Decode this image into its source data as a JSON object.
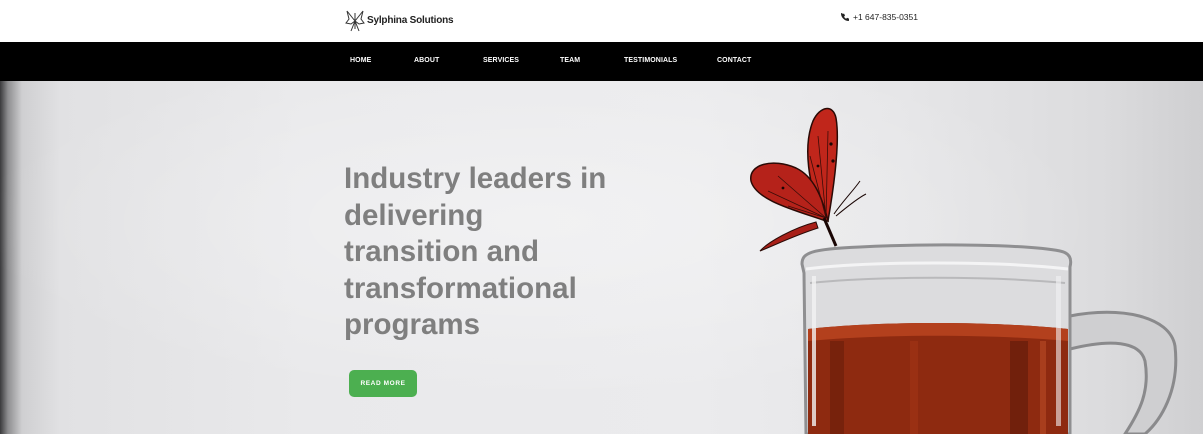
{
  "brand": {
    "name": "Sylphina Solutions",
    "logo_icon": "butterfly-logo-icon"
  },
  "contact": {
    "phone": "+1 647-835-0351",
    "phone_icon": "phone-icon"
  },
  "nav": {
    "items": [
      {
        "label": "HOME"
      },
      {
        "label": "ABOUT"
      },
      {
        "label": "SERVICES"
      },
      {
        "label": "TEAM"
      },
      {
        "label": "TESTIMONIALS"
      },
      {
        "label": "CONTACT"
      }
    ]
  },
  "hero": {
    "headline_lines": [
      "Industry leaders in",
      "delivering",
      "transition and",
      "transformational",
      "programs"
    ],
    "cta_label": "READ MORE",
    "image_subject": "red-butterfly-on-tea-glass"
  },
  "colors": {
    "nav_bg": "#000000",
    "headline": "#7f7f7f",
    "cta_bg": "#4caf50",
    "butterfly": "#c0261b",
    "tea": "#8e2a10"
  }
}
